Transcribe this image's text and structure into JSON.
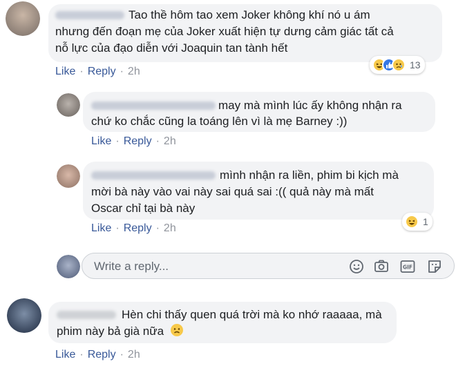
{
  "comments": [
    {
      "lines": [
        "Tao thề hôm tao xem Joker không khí nó u ám",
        "nhưng đến đoạn mẹ của Joker xuất hiện tự dưng cảm giác tất cả",
        "nỗ lực của đạo diễn với Joaquin tan tành hết"
      ],
      "actions": {
        "like": "Like",
        "reply": "Reply",
        "time": "2h"
      },
      "reactions": {
        "icons": [
          "haha-icon",
          "like-icon",
          "sad-icon"
        ],
        "count": "13"
      }
    },
    {
      "lines": [
        "may mà mình lúc ấy không nhận ra",
        "chứ ko chắc cũng la toáng lên vì là mẹ Barney :))"
      ],
      "actions": {
        "like": "Like",
        "reply": "Reply",
        "time": "2h"
      }
    },
    {
      "lines": [
        "mình nhận ra liền, phim bi kịch mà",
        "mời bà này vào vai này sai quá sai :(( quả này mà mất",
        "Oscar chỉ tại bà này"
      ],
      "actions": {
        "like": "Like",
        "reply": "Reply",
        "time": "2h"
      },
      "reactions": {
        "icons": [
          "haha-icon"
        ],
        "count": "1"
      }
    },
    {
      "lines": [
        "Hèn chi thấy quen quá trời mà ko nhớ raaaaa, mà",
        "phim này bả già nữa"
      ],
      "actions": {
        "like": "Like",
        "reply": "Reply",
        "time": "2h"
      }
    }
  ],
  "reply_box": {
    "placeholder": "Write a reply...",
    "tools": [
      "emoji-icon",
      "camera-icon",
      "gif-icon",
      "sticker-icon"
    ]
  },
  "colors": {
    "link": "#385898",
    "bubble": "#f2f3f5",
    "meta": "#90949c"
  }
}
